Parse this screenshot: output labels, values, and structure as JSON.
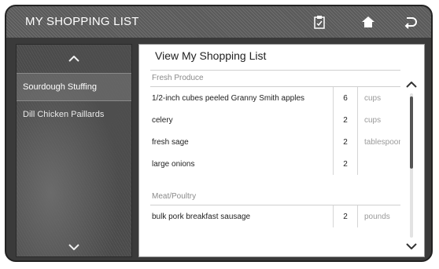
{
  "app": {
    "title": "MY SHOPPING LIST"
  },
  "toolbar": {
    "icons": [
      "list-clipboard-icon",
      "home-icon",
      "back-icon"
    ]
  },
  "sidebar": {
    "recipes": [
      {
        "label": "Sourdough Stuffing",
        "selected": true
      },
      {
        "label": "Dill Chicken Paillards",
        "selected": false
      }
    ]
  },
  "main": {
    "title": "View My Shopping List",
    "categories": [
      {
        "name": "Fresh Produce",
        "items": [
          {
            "name": "1/2-inch cubes peeled Granny Smith apples",
            "qty": "6",
            "unit": "cups"
          },
          {
            "name": "celery",
            "qty": "2",
            "unit": "cups"
          },
          {
            "name": "fresh sage",
            "qty": "2",
            "unit": "tablespoons"
          },
          {
            "name": "large onions",
            "qty": "2",
            "unit": ""
          }
        ]
      },
      {
        "name": "Meat/Poultry",
        "items": [
          {
            "name": "bulk pork breakfast sausage",
            "qty": "2",
            "unit": "pounds"
          }
        ]
      }
    ]
  },
  "colors": {
    "titlebar": "#5f5f5f",
    "panel": "#ffffff",
    "text": "#222222",
    "muted": "#9a9a9a"
  }
}
